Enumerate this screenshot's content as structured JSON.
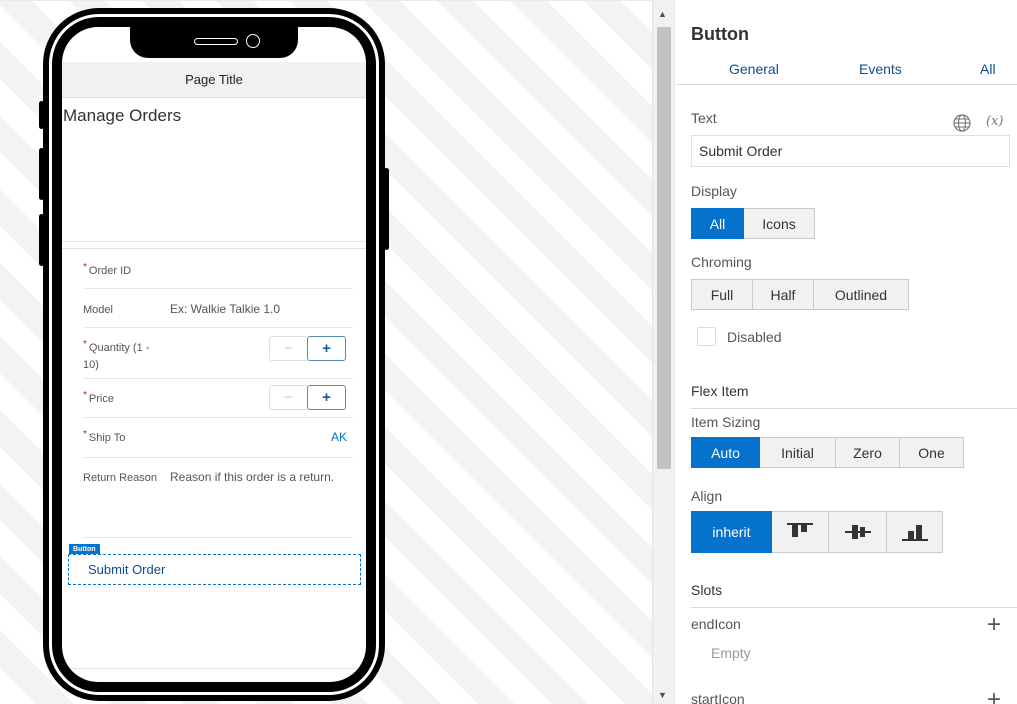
{
  "phone": {
    "page_title": "Page Title",
    "heading": "Manage Orders",
    "fields": [
      {
        "label": "Order ID",
        "required": true,
        "value": ""
      },
      {
        "label": "Model",
        "required": false,
        "value": "Ex: Walkie Talkie 1.0"
      },
      {
        "label": "Quantity (1 -",
        "label2": "10)",
        "required": true,
        "minus": "−",
        "plus": "+"
      },
      {
        "label": "Price",
        "required": true,
        "minus": "−",
        "plus": "+"
      },
      {
        "label": "Ship To",
        "required": true,
        "value": "AK"
      },
      {
        "label": "Return Reason",
        "required": false,
        "value": "Reason if this order is a return."
      }
    ],
    "required_mark": "*",
    "button_tag": "Button",
    "button_label": "Submit Order"
  },
  "panel": {
    "title": "Button",
    "tabs": [
      "General",
      "Events",
      "All"
    ],
    "text_label": "Text",
    "text_value": "Submit Order",
    "var_symbol": "(x)",
    "display_label": "Display",
    "display_options": [
      "All",
      "Icons"
    ],
    "display_selected": "All",
    "chroming_label": "Chroming",
    "chroming_options": [
      "Full",
      "Half",
      "Outlined"
    ],
    "disabled_label": "Disabled",
    "flex_item_title": "Flex Item",
    "item_sizing_label": "Item Sizing",
    "item_sizing_options": [
      "Auto",
      "Initial",
      "Zero",
      "One"
    ],
    "item_sizing_selected": "Auto",
    "align_label": "Align",
    "align_options": [
      "inherit",
      "align-top-icon",
      "align-center-icon",
      "align-bottom-icon"
    ],
    "align_selected": "inherit",
    "slots_title": "Slots",
    "slots": [
      {
        "name": "endIcon",
        "value": "Empty"
      },
      {
        "name": "startIcon"
      }
    ],
    "plus_symbol": "+"
  },
  "colors": {
    "accent": "#0572ce",
    "required": "#d0112b",
    "link": "#0b4f91"
  }
}
